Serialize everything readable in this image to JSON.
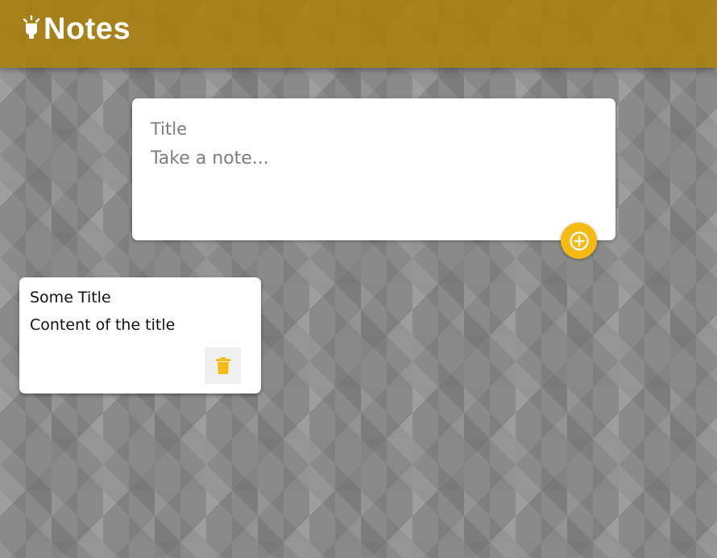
{
  "header": {
    "title": "Notes",
    "icon": "lightbulb-icon",
    "color": "#aa810e"
  },
  "create_area": {
    "title_placeholder": "Title",
    "content_placeholder": "Take a note...",
    "title_value": "",
    "content_value": "",
    "add_icon": "plus-circle-icon",
    "accent": "#f5ba13"
  },
  "notes": [
    {
      "title": "Some Title",
      "content": "Content of the title",
      "delete_icon": "trash-icon"
    }
  ]
}
